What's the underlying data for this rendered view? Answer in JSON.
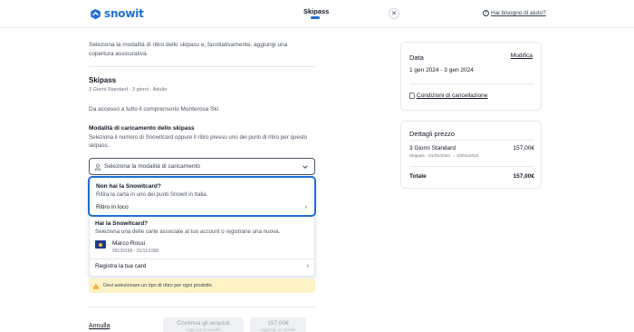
{
  "header": {
    "logo_text": "snowit",
    "tab_label": "Skipass",
    "close_symbol": "✕",
    "help_label": "Hai bisogno di aiuto?",
    "help_symbol": "?",
    "accent_color": "#1e6fd9"
  },
  "main": {
    "intro": "Seleziona la modalità di ritiro dello skipass e, facoltativamente, aggiungi una copertura assicurativa.",
    "section_title": "Skipass",
    "section_sub": "3 Giorni Standard · 3 giorni · Adulto",
    "access_text": "Da accesso a tutto il comprensorio Monterosa Ski.",
    "mode_title": "Modalità di caricamento dello skipass",
    "mode_desc": "Seleziona il numero di Snowitcard oppure il ritiro presso uno dei punti di ritiro per questo skipass.",
    "select_placeholder": "Seleziona la modalità di caricamento"
  },
  "dropdown": {
    "no_card": {
      "title": "Non hai la Snowitcard?",
      "desc": "Ritira la carta in uno dei punti Snowit in Italia.",
      "option_label": "Ritiro in loco"
    },
    "have_card": {
      "title": "Hai la Snowitcard?",
      "desc": "Seleziona una delle carte associate al tuo account o registrane una nuova.",
      "card_name": "Marco Rossi",
      "card_number": "99129199 - 21/11/1990",
      "register_label": "Registra la tua card"
    },
    "arrow_symbol": "›"
  },
  "warning": {
    "text": "Devi selezionare un tipo di ritiro per ogni prodotto"
  },
  "footer": {
    "cancel_label": "Annulla",
    "continue_label": "Continua gli acquisti",
    "continue_sub": "Aggiungi al carrello",
    "price_label": "157,00€",
    "price_sub": "Aggiungi al carrello"
  },
  "date_card": {
    "title": "Data",
    "edit_label": "Modifica",
    "range": "1 gen 2024 - 3 gen 2024",
    "cancel_conditions": "Condizioni di cancellazione"
  },
  "prices": {
    "title": "Dettagli prezzo",
    "item_name": "3 Giorni Standard",
    "item_price": "157,00€",
    "item_detail": "Skipass - 01/01/2024 → 03/01/2024",
    "total_label": "Totale",
    "total_value": "157,00€"
  }
}
